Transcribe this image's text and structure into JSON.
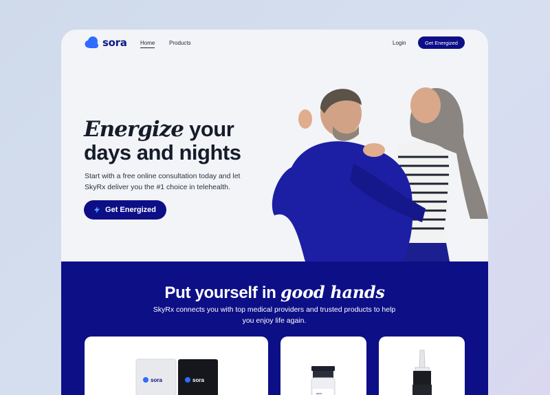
{
  "brand": {
    "name": "sora",
    "color": "#0d0f87"
  },
  "nav": {
    "links": [
      "Home",
      "Products"
    ],
    "login": "Login",
    "cta": "Get Energized"
  },
  "hero": {
    "title_italic": "Energize",
    "title_rest1": " your",
    "title_line2": "days and nights",
    "subtitle": "Start with a free online consultation today and let SkyRx deliver you the #1 choice in telehealth.",
    "cta": "Get Energized",
    "cta_icon": "bolt-icon"
  },
  "section": {
    "title_prefix": "Put yourself in ",
    "title_italic": "good hands",
    "subtitle": "SkyRx connects you with top medical providers and trusted products to help you enjoy life again."
  },
  "products": {
    "packet_label_1": "sora",
    "packet_label_2": "sora",
    "vial_label": "sora"
  }
}
